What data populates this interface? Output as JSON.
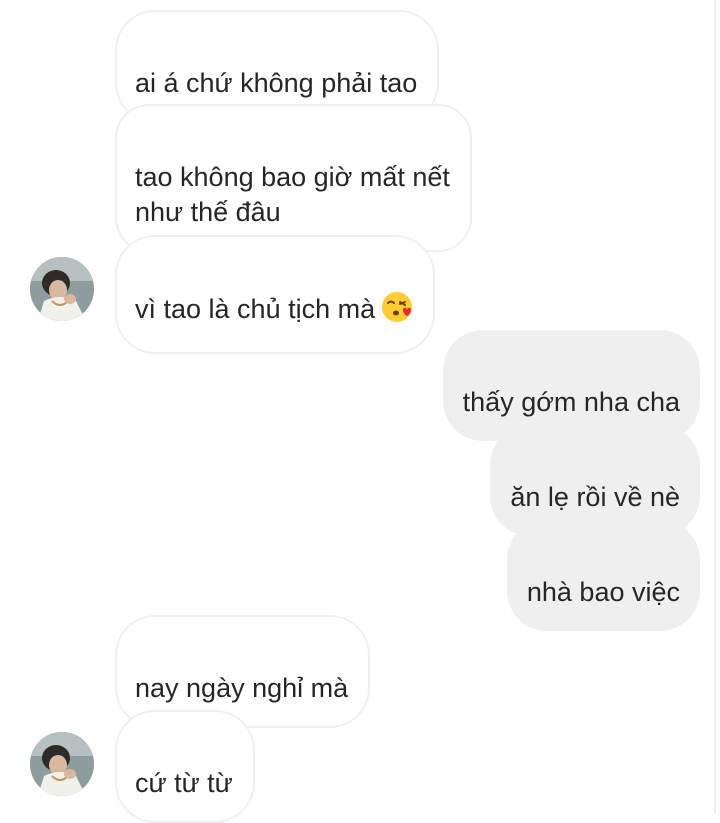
{
  "thread": {
    "messages": [
      {
        "side": "in",
        "text": "ai á chứ không phải tao"
      },
      {
        "side": "in",
        "text": "tao không bao giờ mất nết\nnhư thế đâu"
      },
      {
        "side": "in",
        "text": "vì tao là chủ tịch mà",
        "emoji": "face-blowing-kiss-emoji"
      },
      {
        "side": "out",
        "text": "thấy gớm nha cha"
      },
      {
        "side": "out",
        "text": "ăn lẹ rồi về nè"
      },
      {
        "side": "out",
        "text": "nhà bao việc"
      },
      {
        "side": "in",
        "text": "nay ngày nghỉ mà"
      },
      {
        "side": "in",
        "text": "cứ từ từ"
      }
    ]
  },
  "avatar": {
    "icon": "contact-avatar-photo"
  },
  "colors": {
    "incoming_bubble_border": "#efefef",
    "outgoing_bubble_bg": "#efefef",
    "text": "#262626"
  }
}
